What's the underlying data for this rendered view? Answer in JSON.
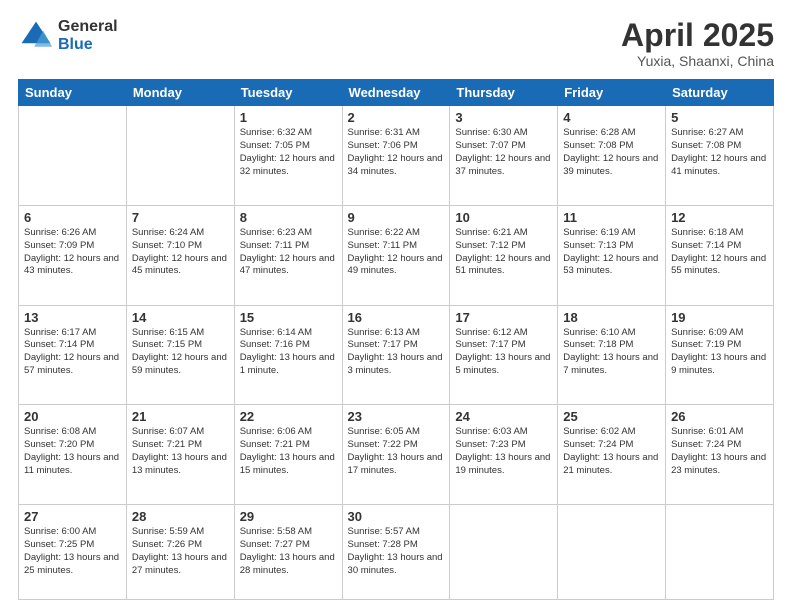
{
  "logo": {
    "general": "General",
    "blue": "Blue"
  },
  "header": {
    "month": "April 2025",
    "location": "Yuxia, Shaanxi, China"
  },
  "weekdays": [
    "Sunday",
    "Monday",
    "Tuesday",
    "Wednesday",
    "Thursday",
    "Friday",
    "Saturday"
  ],
  "days": [
    {
      "date": "",
      "info": ""
    },
    {
      "date": "",
      "info": ""
    },
    {
      "date": "1",
      "info": "Sunrise: 6:32 AM\nSunset: 7:05 PM\nDaylight: 12 hours and 32 minutes."
    },
    {
      "date": "2",
      "info": "Sunrise: 6:31 AM\nSunset: 7:06 PM\nDaylight: 12 hours and 34 minutes."
    },
    {
      "date": "3",
      "info": "Sunrise: 6:30 AM\nSunset: 7:07 PM\nDaylight: 12 hours and 37 minutes."
    },
    {
      "date": "4",
      "info": "Sunrise: 6:28 AM\nSunset: 7:08 PM\nDaylight: 12 hours and 39 minutes."
    },
    {
      "date": "5",
      "info": "Sunrise: 6:27 AM\nSunset: 7:08 PM\nDaylight: 12 hours and 41 minutes."
    },
    {
      "date": "6",
      "info": "Sunrise: 6:26 AM\nSunset: 7:09 PM\nDaylight: 12 hours and 43 minutes."
    },
    {
      "date": "7",
      "info": "Sunrise: 6:24 AM\nSunset: 7:10 PM\nDaylight: 12 hours and 45 minutes."
    },
    {
      "date": "8",
      "info": "Sunrise: 6:23 AM\nSunset: 7:11 PM\nDaylight: 12 hours and 47 minutes."
    },
    {
      "date": "9",
      "info": "Sunrise: 6:22 AM\nSunset: 7:11 PM\nDaylight: 12 hours and 49 minutes."
    },
    {
      "date": "10",
      "info": "Sunrise: 6:21 AM\nSunset: 7:12 PM\nDaylight: 12 hours and 51 minutes."
    },
    {
      "date": "11",
      "info": "Sunrise: 6:19 AM\nSunset: 7:13 PM\nDaylight: 12 hours and 53 minutes."
    },
    {
      "date": "12",
      "info": "Sunrise: 6:18 AM\nSunset: 7:14 PM\nDaylight: 12 hours and 55 minutes."
    },
    {
      "date": "13",
      "info": "Sunrise: 6:17 AM\nSunset: 7:14 PM\nDaylight: 12 hours and 57 minutes."
    },
    {
      "date": "14",
      "info": "Sunrise: 6:15 AM\nSunset: 7:15 PM\nDaylight: 12 hours and 59 minutes."
    },
    {
      "date": "15",
      "info": "Sunrise: 6:14 AM\nSunset: 7:16 PM\nDaylight: 13 hours and 1 minute."
    },
    {
      "date": "16",
      "info": "Sunrise: 6:13 AM\nSunset: 7:17 PM\nDaylight: 13 hours and 3 minutes."
    },
    {
      "date": "17",
      "info": "Sunrise: 6:12 AM\nSunset: 7:17 PM\nDaylight: 13 hours and 5 minutes."
    },
    {
      "date": "18",
      "info": "Sunrise: 6:10 AM\nSunset: 7:18 PM\nDaylight: 13 hours and 7 minutes."
    },
    {
      "date": "19",
      "info": "Sunrise: 6:09 AM\nSunset: 7:19 PM\nDaylight: 13 hours and 9 minutes."
    },
    {
      "date": "20",
      "info": "Sunrise: 6:08 AM\nSunset: 7:20 PM\nDaylight: 13 hours and 11 minutes."
    },
    {
      "date": "21",
      "info": "Sunrise: 6:07 AM\nSunset: 7:21 PM\nDaylight: 13 hours and 13 minutes."
    },
    {
      "date": "22",
      "info": "Sunrise: 6:06 AM\nSunset: 7:21 PM\nDaylight: 13 hours and 15 minutes."
    },
    {
      "date": "23",
      "info": "Sunrise: 6:05 AM\nSunset: 7:22 PM\nDaylight: 13 hours and 17 minutes."
    },
    {
      "date": "24",
      "info": "Sunrise: 6:03 AM\nSunset: 7:23 PM\nDaylight: 13 hours and 19 minutes."
    },
    {
      "date": "25",
      "info": "Sunrise: 6:02 AM\nSunset: 7:24 PM\nDaylight: 13 hours and 21 minutes."
    },
    {
      "date": "26",
      "info": "Sunrise: 6:01 AM\nSunset: 7:24 PM\nDaylight: 13 hours and 23 minutes."
    },
    {
      "date": "27",
      "info": "Sunrise: 6:00 AM\nSunset: 7:25 PM\nDaylight: 13 hours and 25 minutes."
    },
    {
      "date": "28",
      "info": "Sunrise: 5:59 AM\nSunset: 7:26 PM\nDaylight: 13 hours and 27 minutes."
    },
    {
      "date": "29",
      "info": "Sunrise: 5:58 AM\nSunset: 7:27 PM\nDaylight: 13 hours and 28 minutes."
    },
    {
      "date": "30",
      "info": "Sunrise: 5:57 AM\nSunset: 7:28 PM\nDaylight: 13 hours and 30 minutes."
    },
    {
      "date": "",
      "info": ""
    },
    {
      "date": "",
      "info": ""
    },
    {
      "date": "",
      "info": ""
    }
  ]
}
